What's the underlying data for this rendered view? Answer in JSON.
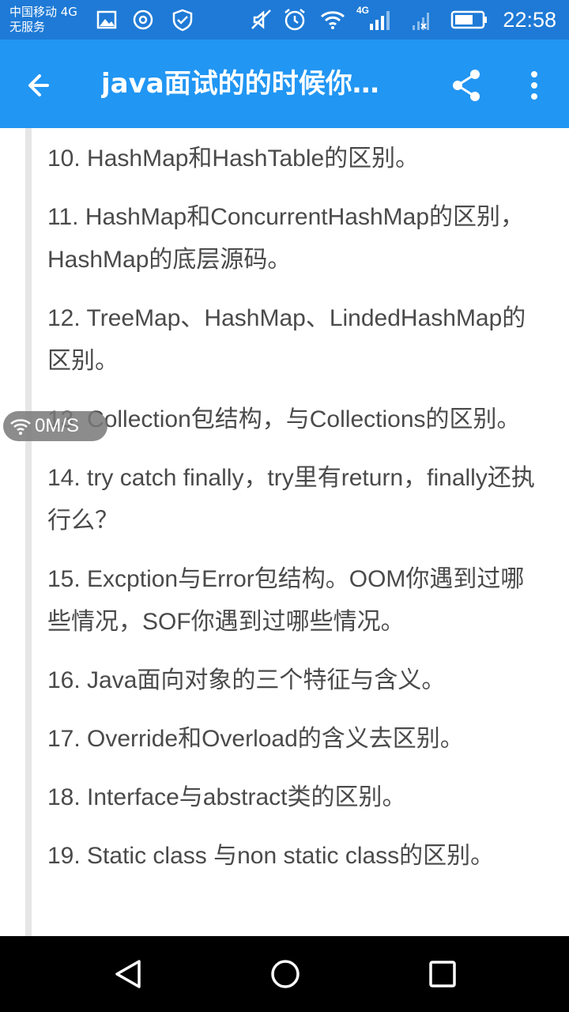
{
  "status_bar": {
    "carrier_line1": "中国移动 4G",
    "carrier_line2": "无服务",
    "network_label": "4G",
    "time": "22:58",
    "icons": [
      "image-icon",
      "settings-icon",
      "shield-icon",
      "mute-icon",
      "alarm-icon",
      "wifi-icon",
      "signal-icon",
      "signal-no-sim-icon",
      "battery-icon"
    ]
  },
  "app_bar": {
    "title": "java面试的的时候你…",
    "back_icon": "arrow-back-icon",
    "share_icon": "share-icon",
    "more_icon": "more-vert-icon"
  },
  "content": {
    "items": [
      "10. HashMap和HashTable的区别。",
      "11. HashMap和ConcurrentHashMap的区别，HashMap的底层源码。",
      "12. TreeMap、HashMap、LindedHashMap的区别。",
      "13. Collection包结构，与Collections的区别。",
      "14. try catch finally，try里有return，finally还执行么？",
      "15. Excption与Error包结构。OOM你遇到过哪些情况，SOF你遇到过哪些情况。",
      "16. Java面向对象的三个特征与含义。",
      "17. Override和Overload的含义去区别。",
      "18. Interface与abstract类的区别。",
      "19. Static class 与non static class的区别。"
    ]
  },
  "speed_widget": {
    "text": "0M/S"
  },
  "nav_bar": {
    "icons": [
      "back-triangle-icon",
      "home-circle-icon",
      "recents-square-icon"
    ]
  },
  "colors": {
    "status_bar": "#1e7ad6",
    "app_bar": "#2196f3",
    "text": "#4a4a4a",
    "quote_bar": "#e6e6e6"
  }
}
